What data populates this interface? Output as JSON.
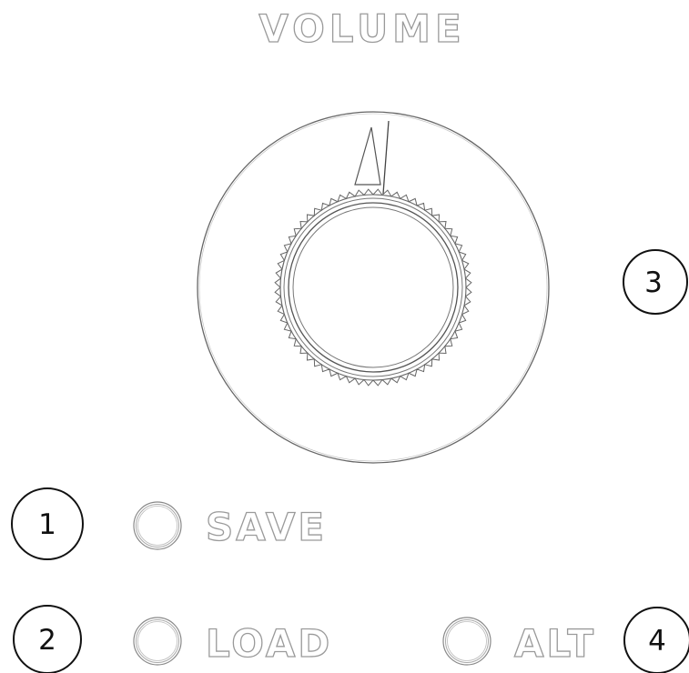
{
  "panel": {
    "title": "VOLUME",
    "buttons": [
      {
        "label": "SAVE"
      },
      {
        "label": "LOAD"
      },
      {
        "label": "ALT"
      }
    ],
    "callouts": [
      "1",
      "2",
      "3",
      "4"
    ]
  },
  "colors": {
    "background": "#ffffff",
    "line": "#555555",
    "label_outline": "#9a9a9a",
    "callout": "#111111"
  }
}
